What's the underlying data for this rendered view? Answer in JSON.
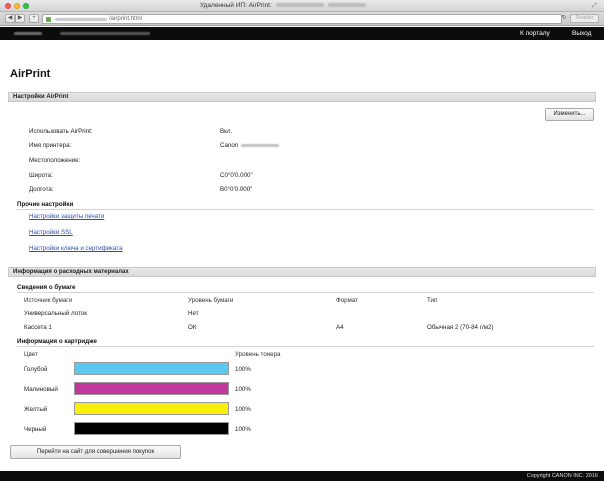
{
  "window": {
    "title": "Удаленный ИП: AirPrint:",
    "traffic_lights": [
      "close",
      "minimize",
      "zoom"
    ]
  },
  "toolbar": {
    "url_text": "/airprint.html",
    "reload_icon": "↻",
    "reader_label": "Reader"
  },
  "header": {
    "portal_link": "К порталу",
    "logout_link": "Выход"
  },
  "page": {
    "title": "AirPrint"
  },
  "airprint_settings": {
    "section_title": "Настройки AirPrint",
    "edit_button": "Изменить...",
    "rows": [
      {
        "label": "Использовать AirPrint:",
        "value": "Вкл."
      },
      {
        "label": "Имя принтера:",
        "value": "Canon"
      },
      {
        "label": "Местоположение:",
        "value": ""
      },
      {
        "label": "Широта:",
        "value": "С0°0'0.000\""
      },
      {
        "label": "Долгота:",
        "value": "В0°0'0.000\""
      }
    ]
  },
  "other_settings": {
    "title": "Прочие настройки",
    "links": [
      "Настройки защиты печати",
      "Настройки SSL",
      "Настройки ключа и сертификата"
    ]
  },
  "consumables": {
    "section_title": "Информация о расходных материалах",
    "paper": {
      "title": "Сведения о бумаге",
      "headers": [
        "Источник бумаги",
        "Уровень бумаги",
        "Формат",
        "Тип"
      ],
      "rows": [
        [
          "Универсальный лоток",
          "Нет",
          "",
          ""
        ],
        [
          "Кассета 1",
          "ОК",
          "A4",
          "Обычная 2 (70-84 г/м2)"
        ]
      ]
    },
    "cartridge": {
      "title": "Информация о картридже",
      "headers": [
        "Цвет",
        "Уровень тонера"
      ],
      "rows": [
        {
          "color": "Голубой",
          "level": "100%",
          "swatch": "#5bc8f0"
        },
        {
          "color": "Малиновый",
          "level": "100%",
          "swatch": "#c1379a"
        },
        {
          "color": "Желтый",
          "level": "100%",
          "swatch": "#f7ef0a"
        },
        {
          "color": "Черный",
          "level": "100%",
          "swatch": "#000000"
        }
      ]
    },
    "shop_button": "Перейти на сайт для совершения покупок"
  },
  "footer": {
    "copyright": "Copyright CANON INC. 2016"
  }
}
